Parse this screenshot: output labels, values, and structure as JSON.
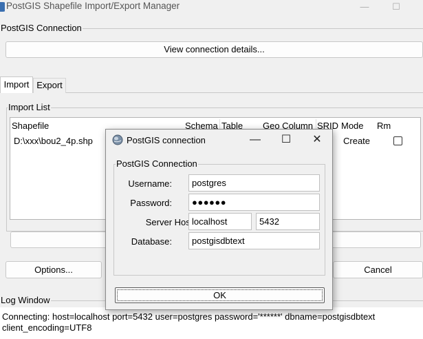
{
  "window": {
    "title": "PostGIS Shapefile Import/Export Manager",
    "minimize_glyph": "—",
    "maximize_glyph": "☐"
  },
  "connection_group": {
    "label": "PostGIS Connection",
    "view_button": "View connection details..."
  },
  "tabs": [
    {
      "label": "Import",
      "active": true
    },
    {
      "label": "Export",
      "active": false
    }
  ],
  "import_list": {
    "label": "Import List",
    "columns": [
      "Shapefile",
      "Schema",
      "Table",
      "Geo Column",
      "SRID",
      "Mode",
      "Rm"
    ],
    "rows": [
      {
        "shapefile": "D:\\xxx\\bou2_4p.shp",
        "mode": "Create",
        "rm": false
      }
    ]
  },
  "buttons": {
    "options": "Options...",
    "cancel": "Cancel"
  },
  "log": {
    "label": "Log Window",
    "lines": [
      "Connecting:  host=localhost port=5432 user=postgres password='******' dbname=postgisdbtext",
      "client_encoding=UTF8"
    ]
  },
  "dialog": {
    "title": "PostGIS connection",
    "min_glyph": "—",
    "max_glyph": "☐",
    "close_glyph": "✕",
    "group_label": "PostGIS Connection",
    "username_label": "Username:",
    "username": "postgres",
    "password_label": "Password:",
    "password": "●●●●●●",
    "host_label": "Server Host:",
    "host": "localhost",
    "port": "5432",
    "database_label": "Database:",
    "database": "postgisdbtext",
    "ok": "OK"
  },
  "colors": {
    "window_bg": "#f0f0f0",
    "border": "#c8c8c8",
    "field_bg": "#ffffff"
  }
}
